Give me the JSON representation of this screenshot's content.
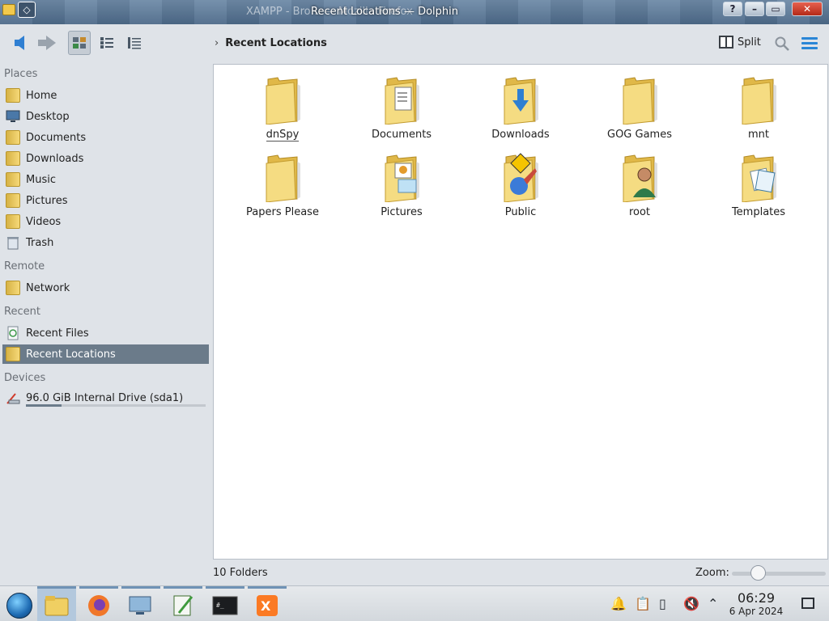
{
  "window": {
    "title": "Recent Locations — Dolphin",
    "background_title": "XAMPP - Bro…                  — Mozilla Firefox",
    "buttons": {
      "help": "?",
      "minimize": "–",
      "maximize": "▭",
      "close": "✕"
    }
  },
  "toolbar": {
    "breadcrumb": "Recent Locations",
    "split_label": "Split"
  },
  "sidebar": {
    "sections": {
      "places": "Places",
      "remote": "Remote",
      "recent": "Recent",
      "devices": "Devices"
    },
    "places": [
      "Home",
      "Desktop",
      "Documents",
      "Downloads",
      "Music",
      "Pictures",
      "Videos",
      "Trash"
    ],
    "remote": [
      "Network"
    ],
    "recent": [
      "Recent Files",
      "Recent Locations"
    ],
    "devices": [
      "96.0 GiB Internal Drive (sda1)"
    ],
    "drive_usage_fraction": 0.2
  },
  "folders": [
    "dnSpy",
    "Documents",
    "Downloads",
    "GOG Games",
    "mnt",
    "Papers Please",
    "Pictures",
    "Public",
    "root",
    "Templates"
  ],
  "status": {
    "count": "10 Folders",
    "zoom_label": "Zoom:"
  },
  "taskbar": {
    "clock_time": "06:29",
    "clock_date": "6 Apr 2024"
  },
  "colors": {
    "accent": "#2f7fd2",
    "selection": "#6b7b8a",
    "folder": "#f1d26a"
  }
}
